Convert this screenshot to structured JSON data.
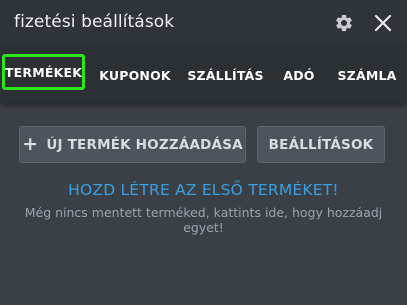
{
  "window": {
    "title": "fizetési beállítások",
    "icons": {
      "settings": "gear-icon",
      "close": "close-icon"
    }
  },
  "tabs": [
    {
      "label": "TERMÉKEK",
      "active": true
    },
    {
      "label": "KUPONOK",
      "active": false
    },
    {
      "label": "SZÁLLÍTÁS",
      "active": false
    },
    {
      "label": "ADÓ",
      "active": false
    },
    {
      "label": "SZÁMLA",
      "active": false
    }
  ],
  "toolbar": {
    "add_label": "ÚJ TERMÉK HOZZÁADÁSA",
    "add_icon": "plus-icon",
    "settings_label": "BEÁLLÍTÁSOK"
  },
  "empty_state": {
    "headline": "HOZD LÉTRE AZ ELSŐ TERMÉKET!",
    "description": "Még nincs mentett terméked, kattints ide, hogy hozzáadj egyet!"
  },
  "colors": {
    "highlight": "#2ee51d",
    "link": "#3a9fe0"
  }
}
